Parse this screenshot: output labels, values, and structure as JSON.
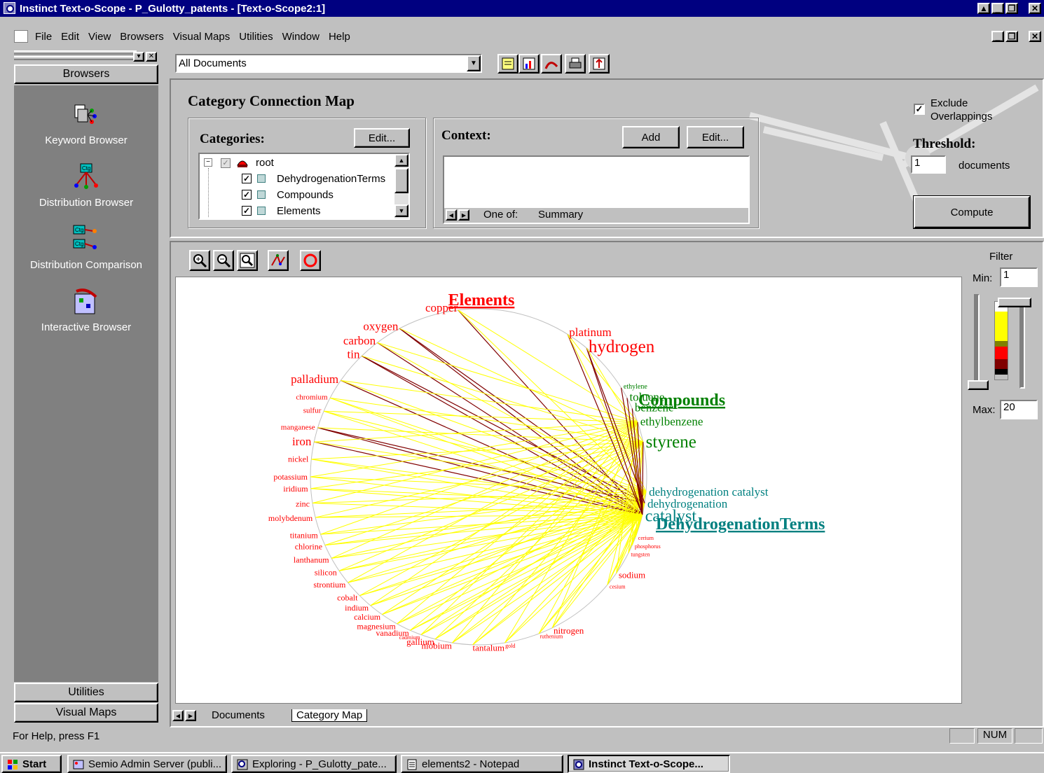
{
  "window": {
    "title": "Instinct Text-o-Scope - P_Gulotty_patents - [Text-o-Scope2:1]"
  },
  "menu": [
    "File",
    "Edit",
    "View",
    "Browsers",
    "Visual Maps",
    "Utilities",
    "Window",
    "Help"
  ],
  "sidebar": {
    "header": "Browsers",
    "items": [
      {
        "label": "Keyword Browser",
        "icon": "keyword-browser-icon"
      },
      {
        "label": "Distribution Browser",
        "icon": "distribution-browser-icon"
      },
      {
        "label": "Distribution Comparison",
        "icon": "distribution-comparison-icon"
      },
      {
        "label": "Interactive Browser",
        "icon": "interactive-browser-icon"
      }
    ],
    "footer": [
      "Utilities",
      "Visual Maps"
    ]
  },
  "toolbar": {
    "document_filter": "All Documents"
  },
  "map_panel": {
    "title": "Category Connection Map",
    "categories_label": "Categories:",
    "edit_label": "Edit...",
    "tree": [
      {
        "label": "root",
        "checked": true,
        "level": 0
      },
      {
        "label": "DehydrogenationTerms",
        "checked": true,
        "level": 1
      },
      {
        "label": "Compounds",
        "checked": true,
        "level": 1
      },
      {
        "label": "Elements",
        "checked": true,
        "level": 1
      }
    ],
    "context_label": "Context:",
    "add_label": "Add",
    "context_edit_label": "Edit...",
    "context_tabs": [
      "One of:",
      "Summary"
    ],
    "exclude_label_1": "Exclude",
    "exclude_label_2": "Overlappings",
    "exclude_checked": true,
    "threshold_label": "Threshold:",
    "threshold_value": "1",
    "threshold_unit": "documents",
    "compute_label": "Compute"
  },
  "filter": {
    "title": "Filter",
    "min_label": "Min:",
    "min_value": "1",
    "max_label": "Max:",
    "max_value": "20",
    "colors": [
      "#ffff00",
      "#808000",
      "#ff0000",
      "#800000",
      "#000000"
    ]
  },
  "map": {
    "headings": {
      "elements": "Elements",
      "compounds": "Compounds",
      "dehydrogenation": "DehydrogenationTerms"
    },
    "colors": {
      "elements": "#ff0000",
      "compounds": "#008000",
      "dehydrogenation": "#008080",
      "link": "#ffff00",
      "strong_link": "#800000"
    },
    "elements_terms": [
      "copper",
      "oxygen",
      "carbon",
      "tin",
      "palladium",
      "chromium",
      "sulfur",
      "manganese",
      "iron",
      "nickel",
      "potassium",
      "iridium",
      "zinc",
      "molybdenum",
      "titanium",
      "chlorine",
      "lanthanum",
      "silicon",
      "strontium",
      "cobalt",
      "indium",
      "calcium",
      "magnesium",
      "vanadium",
      "cadmium",
      "gallium",
      "niobium",
      "tantalum",
      "gold",
      "ruthenium",
      "nitrogen",
      "cesium",
      "sodium",
      "tungsten",
      "phosphorus",
      "cerium",
      "platinum",
      "hydrogen"
    ],
    "compound_terms": [
      "ethylene",
      "toluene",
      "benzene",
      "ethylbenzene",
      "styrene"
    ],
    "dehydrogenation_terms": [
      "dehydrogenation catalyst",
      "dehydrogenation",
      "catalyst"
    ]
  },
  "tabs": [
    "Documents",
    "Category Map"
  ],
  "status": {
    "help": "For Help, press F1",
    "num": "NUM"
  },
  "taskbar": {
    "start": "Start",
    "items": [
      "Semio Admin Server (publi...",
      "Exploring - P_Gulotty_pate...",
      "elements2 - Notepad",
      "Instinct Text-o-Scope..."
    ]
  }
}
